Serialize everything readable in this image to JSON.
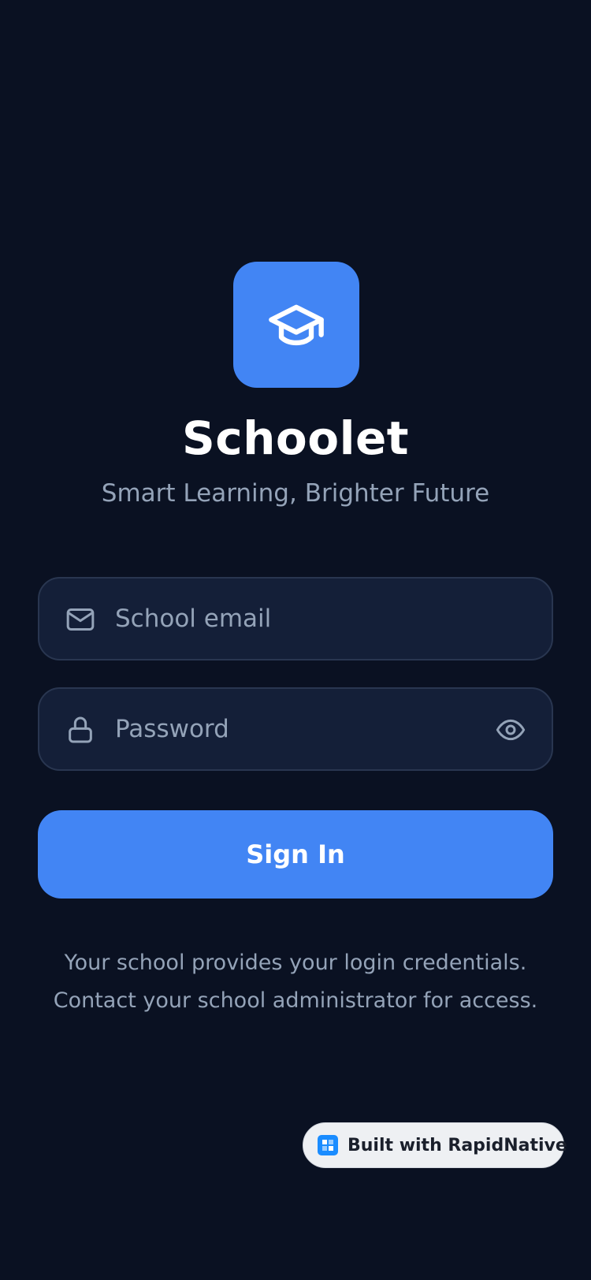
{
  "app": {
    "title": "Schoolet",
    "tagline": "Smart Learning, Brighter Future",
    "logo_icon": "graduation-cap-icon"
  },
  "form": {
    "email": {
      "placeholder": "School email",
      "value": "",
      "icon": "mail-icon"
    },
    "password": {
      "placeholder": "Password",
      "value": "",
      "icon": "lock-icon",
      "toggle_icon": "eye-icon"
    },
    "submit_label": "Sign In"
  },
  "help": {
    "line1": "Your school provides your login credentials.",
    "line2": "Contact your school administrator for access."
  },
  "badge": {
    "label": "Built with RapidNative"
  },
  "colors": {
    "background": "#0a1122",
    "accent": "#4285f4",
    "field_background": "#141f38",
    "field_border": "#293650",
    "muted_text": "#94a3b8"
  }
}
